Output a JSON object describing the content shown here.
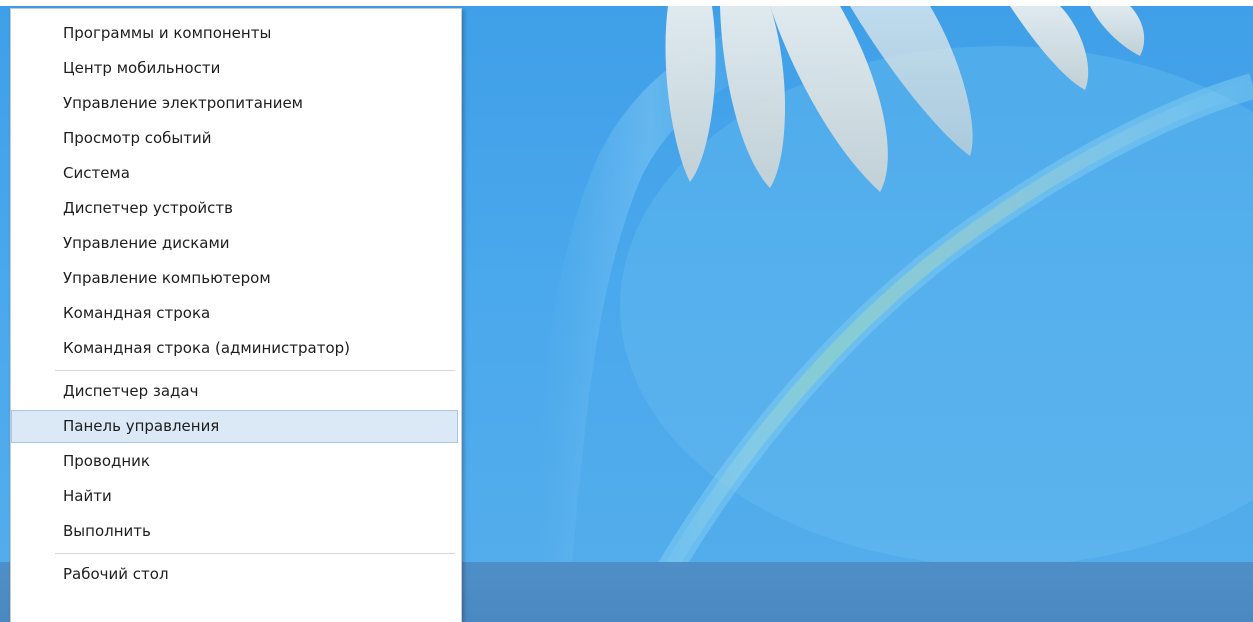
{
  "menu": {
    "group1": [
      {
        "label": "Программы и компоненты"
      },
      {
        "label": "Центр мобильности"
      },
      {
        "label": "Управление электропитанием"
      },
      {
        "label": "Просмотр событий"
      },
      {
        "label": "Система"
      },
      {
        "label": "Диспетчер устройств"
      },
      {
        "label": "Управление дисками"
      },
      {
        "label": "Управление компьютером"
      },
      {
        "label": "Командная строка"
      },
      {
        "label": "Командная строка (администратор)"
      }
    ],
    "group2": [
      {
        "label": "Диспетчер задач"
      },
      {
        "label": "Панель управления",
        "highlighted": true
      },
      {
        "label": "Проводник"
      },
      {
        "label": "Найти"
      },
      {
        "label": "Выполнить"
      }
    ],
    "group3": [
      {
        "label": "Рабочий стол"
      }
    ]
  },
  "colors": {
    "wallpaper": "#4aa8ec",
    "taskbar": "#4a88c2",
    "highlight": "#dbe8f6",
    "highlight_border": "#a9c6e5"
  }
}
